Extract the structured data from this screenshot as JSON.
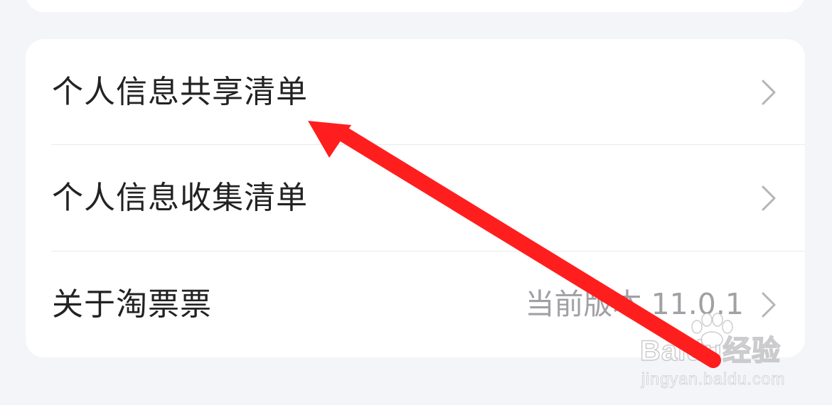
{
  "settings": {
    "items": [
      {
        "label": "个人信息共享清单",
        "value": "",
        "icon": "chevron-right-icon"
      },
      {
        "label": "个人信息收集清单",
        "value": "",
        "icon": "chevron-right-icon"
      },
      {
        "label": "关于淘票票",
        "value": "当前版本 11.0.1",
        "icon": "chevron-right-icon"
      }
    ]
  },
  "annotation": {
    "arrow_color": "#ff1e1e",
    "arrow_icon": "red-annotation-arrow"
  },
  "watermark": {
    "brand": "Baidu经验",
    "domain": "jingyan.baidu.com",
    "icon": "paw-logo-icon"
  },
  "colors": {
    "background": "#f4f5f8",
    "card": "#ffffff",
    "label_text": "#222222",
    "value_text": "#a0a0a5",
    "chevron": "#b4b4b9",
    "divider": "#e9e9ec"
  }
}
